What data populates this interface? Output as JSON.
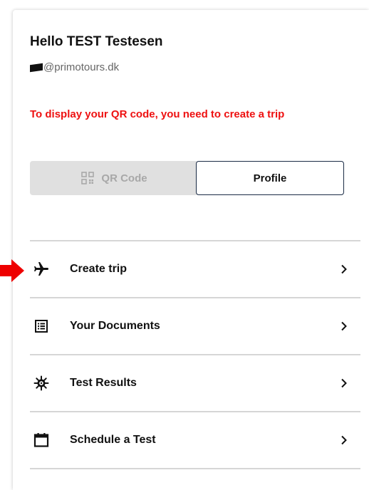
{
  "user": {
    "greeting": "Hello TEST Testesen",
    "email_domain": "@primotours.dk"
  },
  "warning": "To display your QR code, you need to create a trip",
  "buttons": {
    "qr_label": "QR Code",
    "profile_label": "Profile"
  },
  "menu": {
    "items": [
      {
        "label": "Create trip",
        "icon": "airplane-icon"
      },
      {
        "label": "Your Documents",
        "icon": "document-list-icon"
      },
      {
        "label": "Test Results",
        "icon": "virus-icon"
      },
      {
        "label": "Schedule a Test",
        "icon": "calendar-icon"
      }
    ]
  },
  "colors": {
    "warning": "#ee1111",
    "arrow": "#ee0000",
    "profile_border": "#1a2b45",
    "disabled_bg": "#e0e0e0",
    "disabled_text": "#a8a8a8"
  }
}
